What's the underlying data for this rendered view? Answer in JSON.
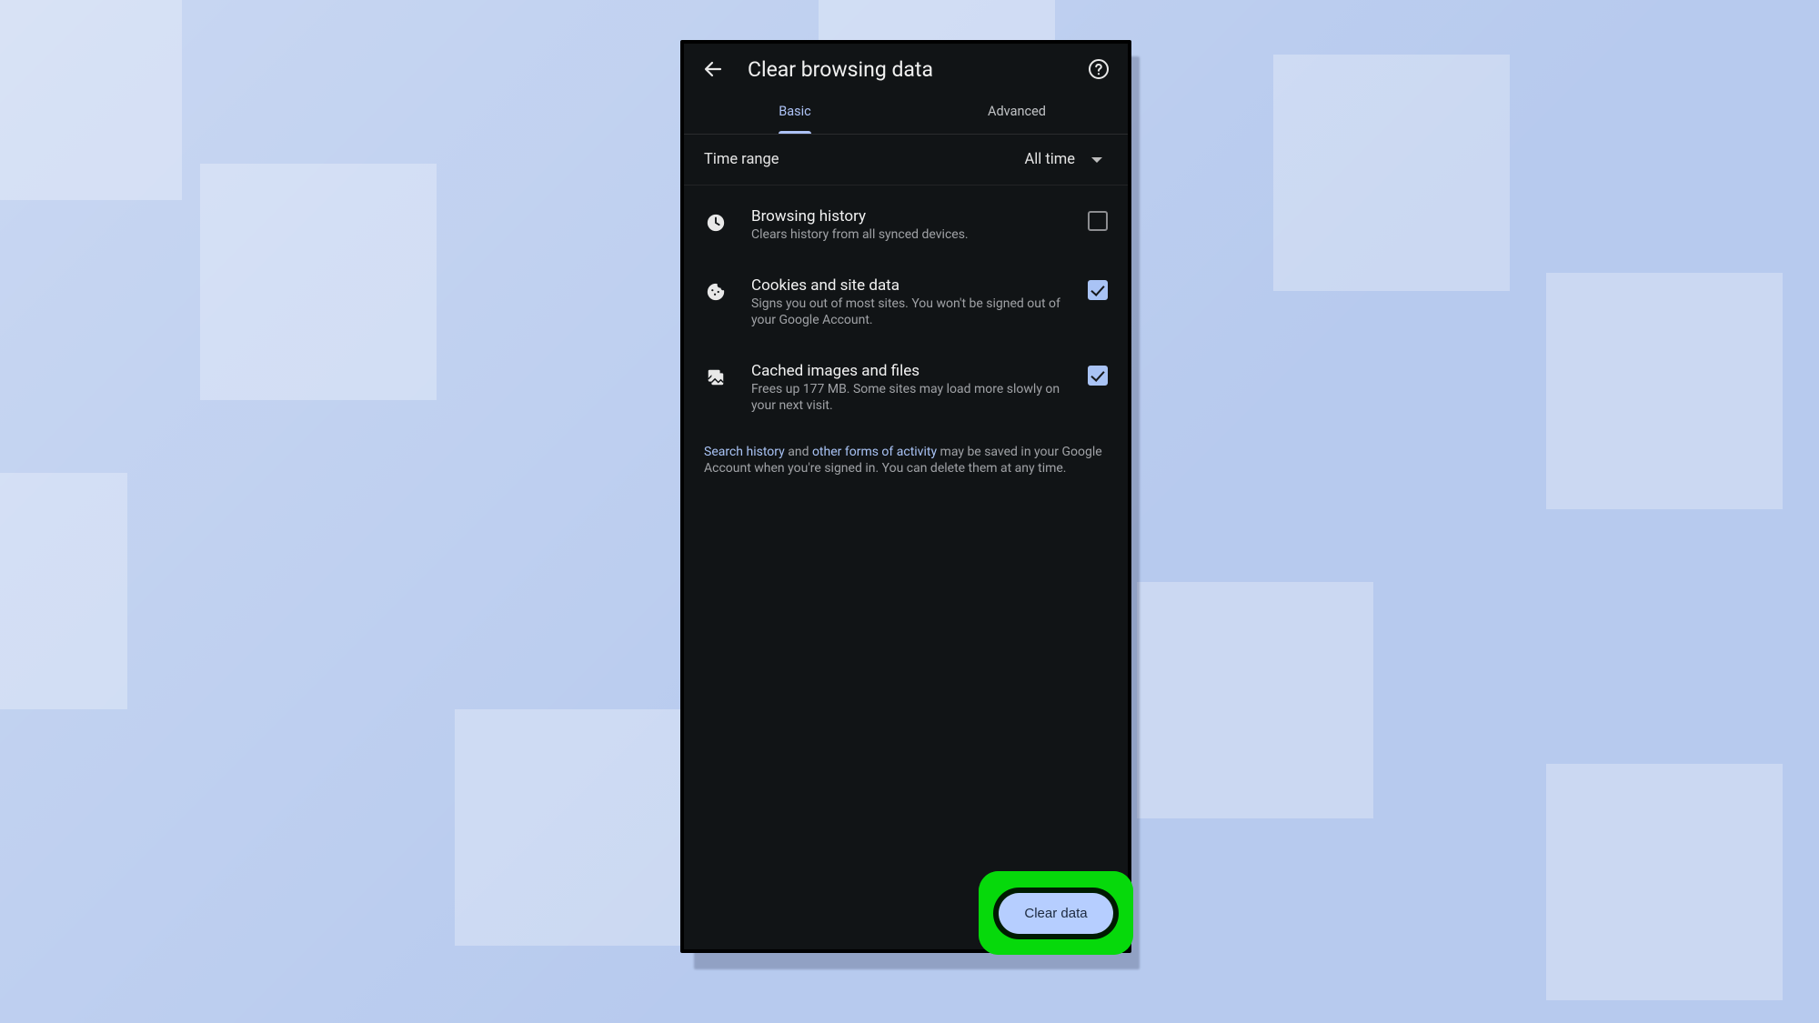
{
  "colors": {
    "accent": "#adc2f5",
    "button_bg": "#b6ceff",
    "highlight": "#06d90b",
    "background": "#111416"
  },
  "header": {
    "title": "Clear browsing data"
  },
  "tabs": {
    "basic": "Basic",
    "advanced": "Advanced",
    "active": "basic"
  },
  "time_range": {
    "label": "Time range",
    "value": "All time"
  },
  "items": [
    {
      "icon": "clock-icon",
      "title": "Browsing history",
      "subtitle": "Clears history from all synced devices.",
      "checked": false
    },
    {
      "icon": "cookie-icon",
      "title": "Cookies and site data",
      "subtitle": "Signs you out of most sites. You won't be signed out of your Google Account.",
      "checked": true
    },
    {
      "icon": "image-icon",
      "title": "Cached images and files",
      "subtitle": "Frees up 177 MB. Some sites may load more slowly on your next visit.",
      "checked": true
    }
  ],
  "footer_note": {
    "link1": "Search history",
    "text1": " and ",
    "link2": "other forms of activity",
    "text2": " may be saved in your Google Account when you're signed in. You can delete them at any time."
  },
  "action": {
    "clear_label": "Clear data"
  }
}
